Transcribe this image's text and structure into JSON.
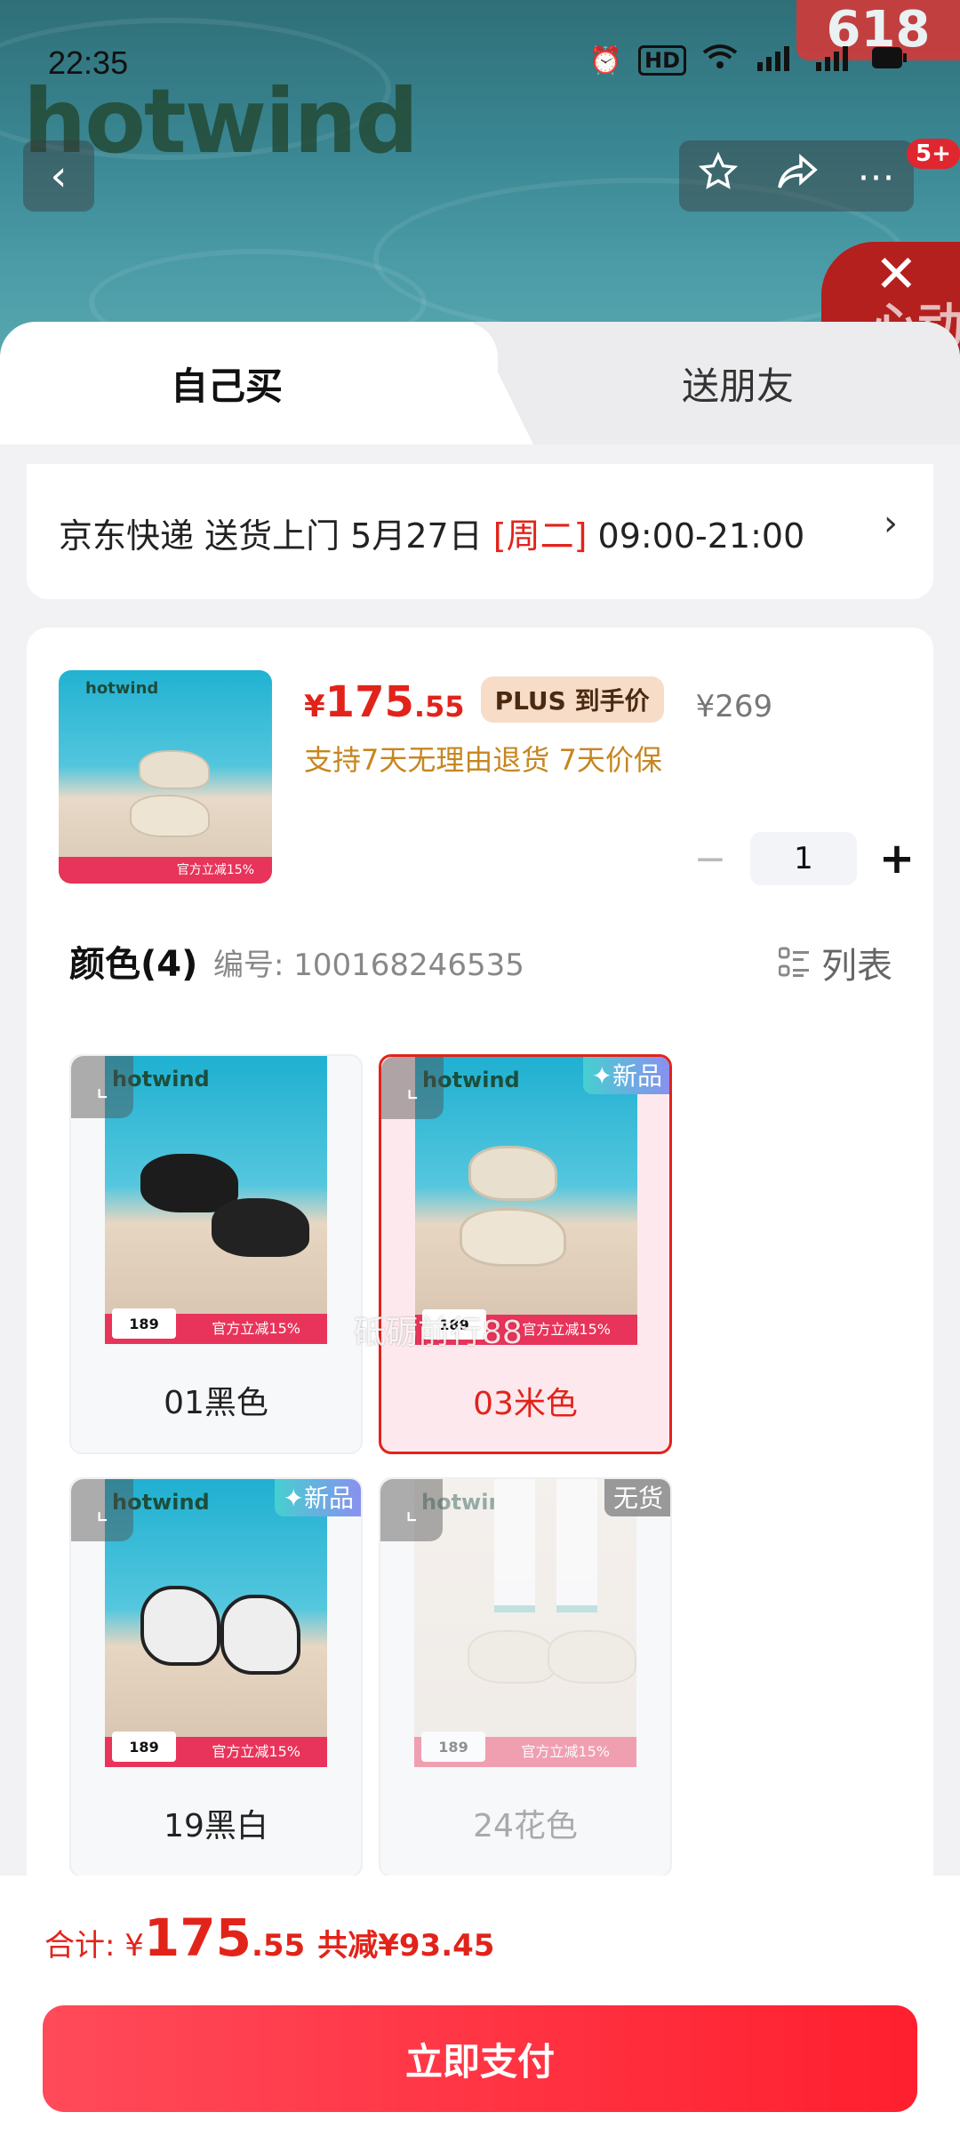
{
  "status_bar": {
    "time": "22:35",
    "icons": [
      "alarm-icon",
      "hd-icon",
      "wifi-icon",
      "5g-signal-icon",
      "5g-signal-icon",
      "battery-icon"
    ]
  },
  "hero": {
    "brand_logo": "hotwind",
    "promo_badge": "618",
    "cart_badge": "5+",
    "close_text": "心动"
  },
  "tabs": {
    "self": "自己买",
    "friend": "送朋友"
  },
  "delivery": {
    "text_prefix": "京东快递 送货上门 5月27日 ",
    "day": "[周二]",
    "time_window": " 09:00-21:00"
  },
  "product": {
    "currency": "¥",
    "price_int": "175",
    "price_dec": ".55",
    "plus_tag": "PLUS 到手价",
    "original_price": "¥269",
    "promise": "支持7天无理由退货  7天价保",
    "quantity": "1"
  },
  "colors": {
    "heading": "颜色(4)",
    "sku": "编号: 100168246535",
    "list_toggle": "列表",
    "watermark": "砥砺前行88",
    "items": [
      {
        "label": "01黑色",
        "tag": "",
        "logo": "hotwind",
        "price": "189",
        "banner": "官方立减15%"
      },
      {
        "label": "03米色",
        "tag": "✦新品",
        "logo": "hotwind",
        "price": "189",
        "banner": "官方立减15%"
      },
      {
        "label": "19黑白",
        "tag": "✦新品",
        "logo": "hotwind",
        "price": "189",
        "banner": "官方立减15%"
      },
      {
        "label": "24花色",
        "tag": "无货",
        "logo": "hotwind",
        "price": "189",
        "banner": "官方立减15%"
      }
    ]
  },
  "footer": {
    "total_label": "合计: ¥",
    "total_int": "175",
    "total_dec": ".55",
    "savings": "共减¥93.45",
    "pay_button": "立即支付"
  },
  "colors_theme": {
    "accent": "#e2231a",
    "gold": "#c6861f",
    "pay_gradient_start": "#ff4a5a",
    "pay_gradient_end": "#ff1f2e"
  }
}
